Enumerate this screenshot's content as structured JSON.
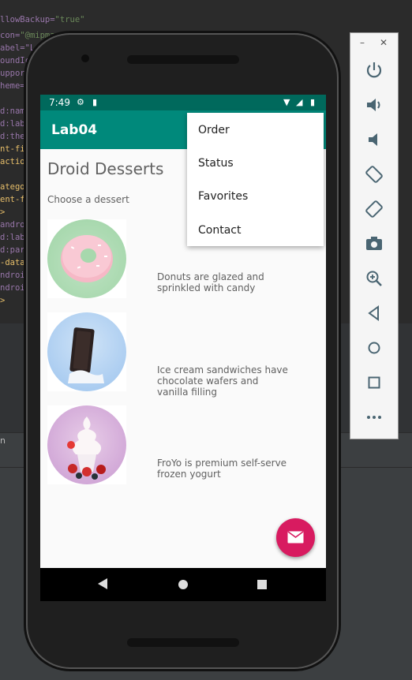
{
  "ide": {
    "code_lines": [
      "llowBackup=\"true\"",
      "con=\"@mipmap/ic_launcher\"",
      "abel=\"L",
      "oundIc",
      "upport",
      "heme=\"",
      "",
      "d:nam",
      "d:lab",
      "d:the",
      "nt-fil",
      "action",
      "",
      "atego",
      "ent-fi",
      ">",
      "androi",
      "d:lab",
      "d:par",
      "-data",
      "ndroi",
      "ndroi",
      ">"
    ],
    "bottom_tab": "n"
  },
  "status_bar": {
    "time": "7:49"
  },
  "app": {
    "title": "Lab04",
    "heading": "Droid Desserts",
    "subheading": "Choose a dessert",
    "desserts": [
      {
        "image": "donut",
        "description": "Donuts are glazed and sprinkled with candy"
      },
      {
        "image": "ice-cream-sandwich",
        "description": "Ice cream sandwiches have chocolate wafers and vanilla filling"
      },
      {
        "image": "froyo",
        "description": "FroYo is premium self-serve frozen yogurt"
      }
    ]
  },
  "overflow_menu": {
    "items": [
      "Order",
      "Status",
      "Favorites",
      "Contact"
    ]
  },
  "fab": {
    "icon": "mail-icon",
    "color": "#d81b60"
  },
  "colors": {
    "status_bar": "#00695c",
    "app_bar": "#00897b",
    "accent": "#d81b60"
  },
  "emulator_toolbar": {
    "buttons": [
      "power-icon",
      "volume-up-icon",
      "volume-down-icon",
      "rotate-left-icon",
      "rotate-right-icon",
      "camera-icon",
      "zoom-icon",
      "back-icon",
      "home-icon",
      "overview-icon",
      "more-icon"
    ]
  }
}
